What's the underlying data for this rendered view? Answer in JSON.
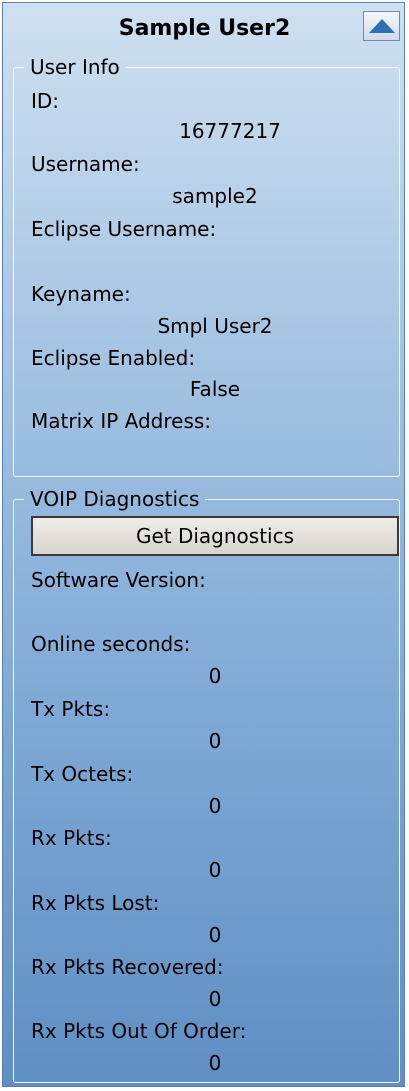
{
  "header": {
    "title": "Sample User2",
    "collapse_icon": "triangle-up-icon"
  },
  "user_info": {
    "legend": "User Info",
    "id_label": "ID:",
    "id_value": "16777217",
    "username_label": "Username:",
    "username_value": "sample2",
    "eclipse_username_label": "Eclipse Username:",
    "eclipse_username_value": "",
    "keyname_label": "Keyname:",
    "keyname_value": "Smpl User2",
    "eclipse_enabled_label": "Eclipse Enabled:",
    "eclipse_enabled_value": "False",
    "matrix_ip_label": "Matrix IP Address:",
    "matrix_ip_value": ""
  },
  "voip": {
    "legend": "VOIP Diagnostics",
    "button_label": "Get Diagnostics",
    "software_version_label": "Software Version:",
    "software_version_value": "",
    "online_seconds_label": "Online seconds:",
    "online_seconds_value": "0",
    "tx_pkts_label": "Tx Pkts:",
    "tx_pkts_value": "0",
    "tx_octets_label": "Tx Octets:",
    "tx_octets_value": "0",
    "rx_pkts_label": "Rx Pkts:",
    "rx_pkts_value": "0",
    "rx_pkts_lost_label": "Rx Pkts Lost:",
    "rx_pkts_lost_value": "0",
    "rx_pkts_recovered_label": "Rx Pkts Recovered:",
    "rx_pkts_recovered_value": "0",
    "rx_pkts_out_of_order_label": "Rx Pkts Out Of Order:",
    "rx_pkts_out_of_order_value": "0"
  }
}
